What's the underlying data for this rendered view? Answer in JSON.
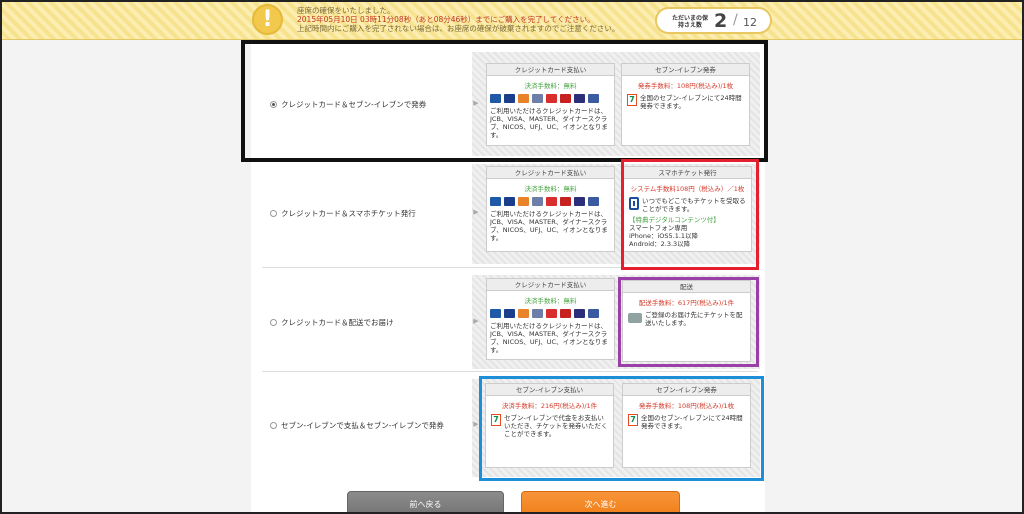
{
  "header": {
    "warning_symbol": "!",
    "notice_line1": "座席の確保をいたしました。",
    "notice_line2": "2015年05月10日 03時11分08秒（あと08分46秒）までにご購入を完了してください。",
    "notice_line3": "上記時間内にご購入を完了されない場合は、お座席の確保が破棄されますのでご注意ください。",
    "counter_label": "ただいまの保持さえ数",
    "counter_current": "2",
    "counter_separator": "/",
    "counter_total": "12"
  },
  "common": {
    "credit_card_title": "クレジットカード支払い",
    "credit_card_fee": "決済手数料：無料",
    "credit_card_desc": "ご利用いただけるクレジットカードは、JCB、VISA、MASTER、ダイナースクラブ、NICOS、UFJ、UC、イオンとなります。",
    "card_logos": [
      {
        "name": "jcb-logo",
        "color": "#1e5aa8"
      },
      {
        "name": "visa-logo",
        "color": "#1a3e8c"
      },
      {
        "name": "mastercard-logo",
        "color": "#e8832a"
      },
      {
        "name": "diners-logo",
        "color": "#6d7fa8"
      },
      {
        "name": "nicos-logo",
        "color": "#d92e2e"
      },
      {
        "name": "ufj-logo",
        "color": "#c72020"
      },
      {
        "name": "uc-logo",
        "color": "#2b2f7a"
      },
      {
        "name": "aeon-logo",
        "color": "#3a5ba0"
      }
    ],
    "seven_issue_title": "セブン-イレブン発券",
    "seven_issue_fee": "発券手数料：108円(税込み)/1枚",
    "seven_issue_desc": "全国のセブン-イレブンにて24時間発券できます。",
    "seven_glyph": "7",
    "row_arrow": "▶"
  },
  "options": [
    {
      "label": "クレジットカード＆セブン-イレブンで発券",
      "selected": true
    },
    {
      "label": "クレジットカード＆スマホチケット発行",
      "selected": false
    },
    {
      "label": "クレジットカード＆配送でお届け",
      "selected": false
    },
    {
      "label": "セブン-イレブンで支払＆セブン-イレブンで発券",
      "selected": false
    }
  ],
  "smartphone": {
    "title": "スマホチケット発行",
    "fee": "システム手数料108円（税込み）／1枚",
    "desc": "いつでもどこでもチケットを受取ることができます。",
    "bonus": "【特典デジタルコンテンツ付】",
    "req1": "スマートフォン専用",
    "req2": "iPhone：iOS5.1.1以降",
    "req3": "Android：2.3.3以降"
  },
  "delivery": {
    "title": "配送",
    "fee": "配送手数料：617円(税込み)/1件",
    "desc": "ご登録のお届け先にチケットを配送いたします。"
  },
  "seven_pay": {
    "title": "セブン-イレブン支払い",
    "fee": "決済手数料：216円(税込み)/1件",
    "desc": "セブン-イレブンで代金をお支払いいただき、チケットを発券いただくことができます。"
  },
  "buttons": {
    "back": "前へ戻る",
    "next": "次へ進む"
  },
  "colors": {
    "accent_orange": "#f08a24",
    "highlight_black": "#111111",
    "highlight_red": "#e5202e",
    "highlight_purple": "#9a3ea8",
    "highlight_blue": "#1c8fd8"
  }
}
